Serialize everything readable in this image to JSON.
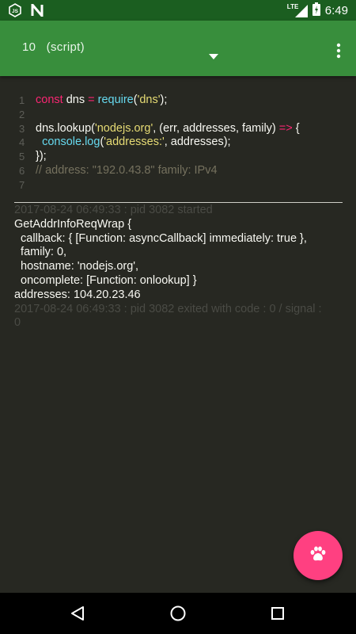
{
  "status_bar": {
    "left_icons": [
      "nodejs-icon",
      "n-notification-icon"
    ],
    "network_label": "LTE",
    "time": "6:49"
  },
  "app_bar": {
    "title": "10   (script)",
    "dropdown_icon": "dropdown-triangle-icon",
    "menu_icon": "more-vert-icon",
    "color": "#388e3c"
  },
  "editor": {
    "line_numbers": [
      "1",
      "2",
      "3",
      "4",
      "5",
      "6",
      "7"
    ],
    "lines": [
      {
        "segments": [
          {
            "t": "const",
            "c": "kw"
          },
          {
            "t": " dns ",
            "c": ""
          },
          {
            "t": "=",
            "c": "kw"
          },
          {
            "t": " ",
            "c": ""
          },
          {
            "t": "require",
            "c": "fn"
          },
          {
            "t": "(",
            "c": ""
          },
          {
            "t": "'dns'",
            "c": "str"
          },
          {
            "t": ");",
            "c": ""
          }
        ]
      },
      {
        "segments": []
      },
      {
        "segments": [
          {
            "t": "dns.lookup(",
            "c": ""
          },
          {
            "t": "'nodejs.org'",
            "c": "str"
          },
          {
            "t": ", (err, addresses, family) ",
            "c": ""
          },
          {
            "t": "=>",
            "c": "kw"
          },
          {
            "t": " {",
            "c": ""
          }
        ]
      },
      {
        "segments": [
          {
            "t": "  ",
            "c": ""
          },
          {
            "t": "console",
            "c": "fn"
          },
          {
            "t": ".",
            "c": ""
          },
          {
            "t": "log",
            "c": "fn"
          },
          {
            "t": "(",
            "c": ""
          },
          {
            "t": "'addresses:'",
            "c": "str"
          },
          {
            "t": ", addresses);",
            "c": ""
          }
        ]
      },
      {
        "segments": [
          {
            "t": "});",
            "c": ""
          }
        ]
      },
      {
        "segments": [
          {
            "t": "// address: \"192.0.43.8\" family: IPv4",
            "c": "cm"
          }
        ]
      },
      {
        "segments": []
      }
    ]
  },
  "console": {
    "lines": [
      {
        "text": "2017-08-24 06:49:33 : pid 3082 started",
        "meta": true
      },
      {
        "text": "GetAddrInfoReqWrap {",
        "meta": false
      },
      {
        "text": "  callback: { [Function: asyncCallback] immediately: true },",
        "meta": false
      },
      {
        "text": "  family: 0,",
        "meta": false
      },
      {
        "text": "  hostname: 'nodejs.org',",
        "meta": false
      },
      {
        "text": "  oncomplete: [Function: onlookup] }",
        "meta": false
      },
      {
        "text": "addresses: 104.20.23.46",
        "meta": false
      },
      {
        "text": "2017-08-24 06:49:33 : pid 3082 exited with code : 0 / signal :",
        "meta": true
      },
      {
        "text": "0",
        "meta": true
      }
    ]
  },
  "fab": {
    "icon": "paw-icon",
    "color": "#ff4081"
  },
  "nav_bar": {
    "icons": [
      "back-icon",
      "home-icon",
      "recents-icon"
    ]
  }
}
